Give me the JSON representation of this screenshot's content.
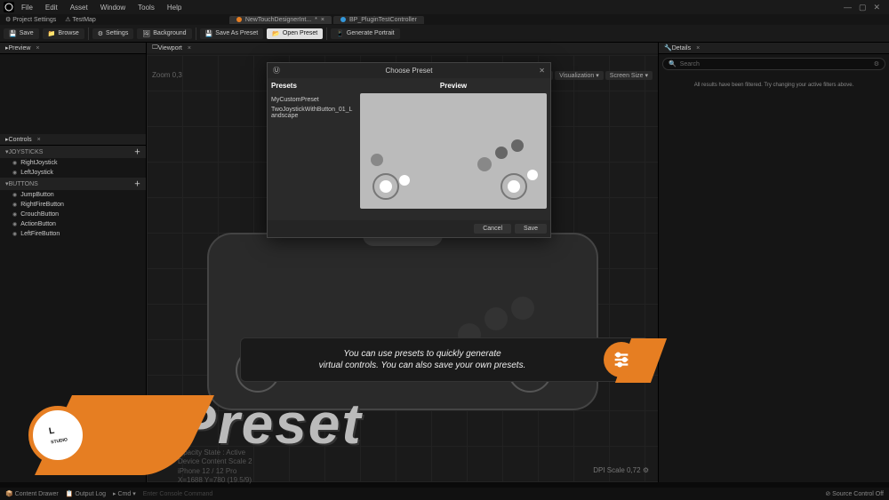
{
  "menu": {
    "items": [
      "File",
      "Edit",
      "Asset",
      "Window",
      "Tools",
      "Help"
    ]
  },
  "secbar": {
    "projectSettings": "Project Settings",
    "testMap": "TestMap"
  },
  "doctabs": [
    {
      "label": "NewTouchDesignerInt...",
      "star": "*",
      "active": true
    },
    {
      "label": "BP_PluginTestController",
      "active": false
    }
  ],
  "toolbar": {
    "save": "Save",
    "browse": "Browse",
    "settings": "Settings",
    "background": "Background",
    "saveAsPreset": "Save As Preset",
    "openPreset": "Open Preset",
    "generatePortrait": "Generate Portrait"
  },
  "left": {
    "previewTab": "Preview",
    "controlsTab": "Controls",
    "groups": [
      {
        "header": "JOYSTICKS",
        "items": [
          "RightJoystick",
          "LeftJoystick"
        ]
      },
      {
        "header": "BUTTONS",
        "items": [
          "JumpButton",
          "RightFireButton",
          "CrouchButton",
          "ActionButton",
          "LeftFireButton"
        ]
      }
    ]
  },
  "viewport": {
    "tab": "Viewport",
    "zoom": "Zoom 0,3",
    "tools": {
      "visualization": "Visualization",
      "screenSize": "Screen Size"
    }
  },
  "modal": {
    "title": "Choose Preset",
    "presetsHeader": "Presets",
    "previewHeader": "Preview",
    "presets": [
      "MyCustomPreset",
      "TwoJoystickWithButton_01_Landscape"
    ],
    "cancel": "Cancel",
    "save": "Save"
  },
  "details": {
    "tab": "Details",
    "searchPlaceholder": "Search",
    "msg": "All results have been filtered. Try changing your active filters above."
  },
  "banner": {
    "text1": "You can use presets to quickly generate",
    "text2": "virtual controls. You can also save your own presets."
  },
  "title": "Preset",
  "device": {
    "l1": "Opacity State : Active",
    "l2": "Device Content Scale 2",
    "l3": "iPhone 12 / 12 Pro",
    "l4": "X=1688 Y=780 (19.5/9)"
  },
  "dpi": "DPI Scale 0,72",
  "status": {
    "contentDrawer": "Content Drawer",
    "outputLog": "Output Log",
    "cmd": "Cmd",
    "cmdInput": "Enter Console Command",
    "sourceControl": "Source Control Off"
  }
}
